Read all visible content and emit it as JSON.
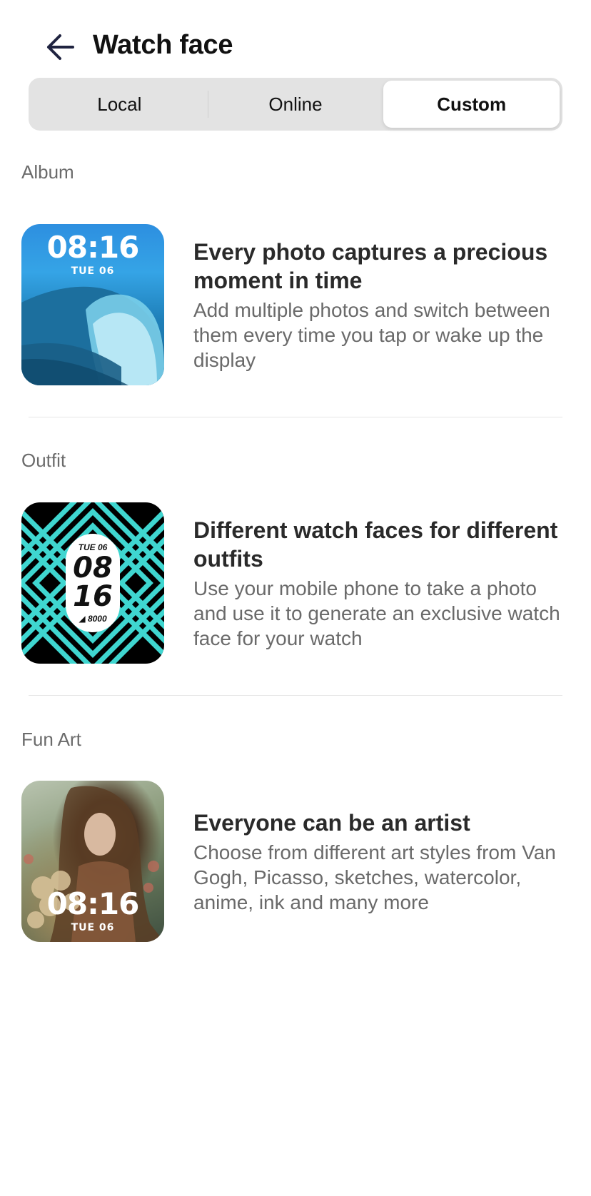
{
  "header": {
    "title": "Watch face",
    "back_icon": "arrow-left-icon"
  },
  "tabs": [
    {
      "label": "Local",
      "active": false
    },
    {
      "label": "Online",
      "active": false
    },
    {
      "label": "Custom",
      "active": true
    }
  ],
  "sections": [
    {
      "label": "Album",
      "title": "Every photo captures a precious moment in time",
      "description": "Add multiple photos and switch between them every time you tap or wake up the display",
      "preview_time": "08:16",
      "preview_date": "TUE 06"
    },
    {
      "label": "Outfit",
      "title": "Different watch faces for different outfits",
      "description": "Use your mobile phone to take a photo and use it to generate an exclusive watch face for your watch",
      "preview_date": "TUE 06",
      "preview_hour": "08",
      "preview_minute": "16",
      "preview_steps": "8000"
    },
    {
      "label": "Fun Art",
      "title": "Everyone can be an artist",
      "description": "Choose from different art styles from Van Gogh, Picasso, sketches, watercolor, anime, ink and many more",
      "preview_time": "08:16",
      "preview_date": "TUE 06"
    }
  ],
  "colors": {
    "accent_teal": "#3fd6d0",
    "segment_bg": "#e3e3e3",
    "label_gray": "#6b6b6b"
  }
}
